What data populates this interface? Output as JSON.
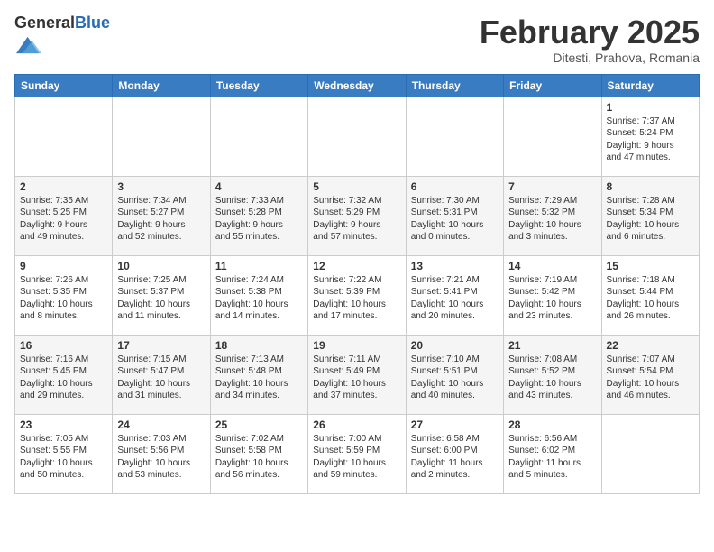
{
  "header": {
    "logo_general": "General",
    "logo_blue": "Blue",
    "month_year": "February 2025",
    "location": "Ditesti, Prahova, Romania"
  },
  "weekdays": [
    "Sunday",
    "Monday",
    "Tuesday",
    "Wednesday",
    "Thursday",
    "Friday",
    "Saturday"
  ],
  "weeks": [
    [
      {
        "day": "",
        "info": ""
      },
      {
        "day": "",
        "info": ""
      },
      {
        "day": "",
        "info": ""
      },
      {
        "day": "",
        "info": ""
      },
      {
        "day": "",
        "info": ""
      },
      {
        "day": "",
        "info": ""
      },
      {
        "day": "1",
        "info": "Sunrise: 7:37 AM\nSunset: 5:24 PM\nDaylight: 9 hours\nand 47 minutes."
      }
    ],
    [
      {
        "day": "2",
        "info": "Sunrise: 7:35 AM\nSunset: 5:25 PM\nDaylight: 9 hours\nand 49 minutes."
      },
      {
        "day": "3",
        "info": "Sunrise: 7:34 AM\nSunset: 5:27 PM\nDaylight: 9 hours\nand 52 minutes."
      },
      {
        "day": "4",
        "info": "Sunrise: 7:33 AM\nSunset: 5:28 PM\nDaylight: 9 hours\nand 55 minutes."
      },
      {
        "day": "5",
        "info": "Sunrise: 7:32 AM\nSunset: 5:29 PM\nDaylight: 9 hours\nand 57 minutes."
      },
      {
        "day": "6",
        "info": "Sunrise: 7:30 AM\nSunset: 5:31 PM\nDaylight: 10 hours\nand 0 minutes."
      },
      {
        "day": "7",
        "info": "Sunrise: 7:29 AM\nSunset: 5:32 PM\nDaylight: 10 hours\nand 3 minutes."
      },
      {
        "day": "8",
        "info": "Sunrise: 7:28 AM\nSunset: 5:34 PM\nDaylight: 10 hours\nand 6 minutes."
      }
    ],
    [
      {
        "day": "9",
        "info": "Sunrise: 7:26 AM\nSunset: 5:35 PM\nDaylight: 10 hours\nand 8 minutes."
      },
      {
        "day": "10",
        "info": "Sunrise: 7:25 AM\nSunset: 5:37 PM\nDaylight: 10 hours\nand 11 minutes."
      },
      {
        "day": "11",
        "info": "Sunrise: 7:24 AM\nSunset: 5:38 PM\nDaylight: 10 hours\nand 14 minutes."
      },
      {
        "day": "12",
        "info": "Sunrise: 7:22 AM\nSunset: 5:39 PM\nDaylight: 10 hours\nand 17 minutes."
      },
      {
        "day": "13",
        "info": "Sunrise: 7:21 AM\nSunset: 5:41 PM\nDaylight: 10 hours\nand 20 minutes."
      },
      {
        "day": "14",
        "info": "Sunrise: 7:19 AM\nSunset: 5:42 PM\nDaylight: 10 hours\nand 23 minutes."
      },
      {
        "day": "15",
        "info": "Sunrise: 7:18 AM\nSunset: 5:44 PM\nDaylight: 10 hours\nand 26 minutes."
      }
    ],
    [
      {
        "day": "16",
        "info": "Sunrise: 7:16 AM\nSunset: 5:45 PM\nDaylight: 10 hours\nand 29 minutes."
      },
      {
        "day": "17",
        "info": "Sunrise: 7:15 AM\nSunset: 5:47 PM\nDaylight: 10 hours\nand 31 minutes."
      },
      {
        "day": "18",
        "info": "Sunrise: 7:13 AM\nSunset: 5:48 PM\nDaylight: 10 hours\nand 34 minutes."
      },
      {
        "day": "19",
        "info": "Sunrise: 7:11 AM\nSunset: 5:49 PM\nDaylight: 10 hours\nand 37 minutes."
      },
      {
        "day": "20",
        "info": "Sunrise: 7:10 AM\nSunset: 5:51 PM\nDaylight: 10 hours\nand 40 minutes."
      },
      {
        "day": "21",
        "info": "Sunrise: 7:08 AM\nSunset: 5:52 PM\nDaylight: 10 hours\nand 43 minutes."
      },
      {
        "day": "22",
        "info": "Sunrise: 7:07 AM\nSunset: 5:54 PM\nDaylight: 10 hours\nand 46 minutes."
      }
    ],
    [
      {
        "day": "23",
        "info": "Sunrise: 7:05 AM\nSunset: 5:55 PM\nDaylight: 10 hours\nand 50 minutes."
      },
      {
        "day": "24",
        "info": "Sunrise: 7:03 AM\nSunset: 5:56 PM\nDaylight: 10 hours\nand 53 minutes."
      },
      {
        "day": "25",
        "info": "Sunrise: 7:02 AM\nSunset: 5:58 PM\nDaylight: 10 hours\nand 56 minutes."
      },
      {
        "day": "26",
        "info": "Sunrise: 7:00 AM\nSunset: 5:59 PM\nDaylight: 10 hours\nand 59 minutes."
      },
      {
        "day": "27",
        "info": "Sunrise: 6:58 AM\nSunset: 6:00 PM\nDaylight: 11 hours\nand 2 minutes."
      },
      {
        "day": "28",
        "info": "Sunrise: 6:56 AM\nSunset: 6:02 PM\nDaylight: 11 hours\nand 5 minutes."
      },
      {
        "day": "",
        "info": ""
      }
    ]
  ]
}
